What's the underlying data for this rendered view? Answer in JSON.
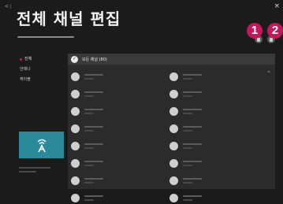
{
  "header": {
    "title": "전체 채널 편집",
    "back_icon": "back-arrow-icon",
    "close_label": "×"
  },
  "callouts": [
    "1",
    "2"
  ],
  "sidebar": {
    "items": [
      {
        "label": "전체",
        "active": true,
        "color": "#c2185b"
      },
      {
        "label": "안테나",
        "active": false
      },
      {
        "label": "케이블",
        "active": false
      }
    ]
  },
  "content": {
    "all_channels_label": "모든 채널 (80)",
    "scroll_up_label": "⌃",
    "channel_rows": 8,
    "channel_columns": 2
  },
  "colors": {
    "accent": "#c2185b",
    "background": "#1b1b1b",
    "panel": "#2b2b2b",
    "preview": "#2a8a9a"
  }
}
